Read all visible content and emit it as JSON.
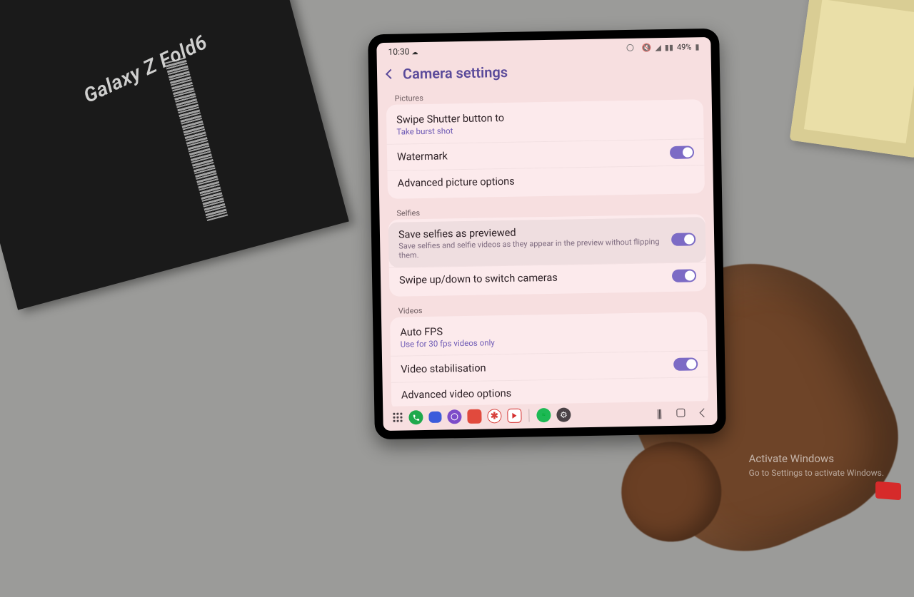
{
  "prop_box_label": "Galaxy Z Fold6",
  "status": {
    "time": "10:30",
    "battery_text": "49%",
    "icons": [
      "mute",
      "wifi",
      "signal1",
      "signal2"
    ]
  },
  "header": {
    "title": "Camera settings"
  },
  "sections": {
    "pictures": {
      "header": "Pictures",
      "swipe_shutter_title": "Swipe Shutter button to",
      "swipe_shutter_sub": "Take burst shot",
      "watermark_title": "Watermark",
      "advanced_pic_title": "Advanced picture options"
    },
    "selfies": {
      "header": "Selfies",
      "save_preview_title": "Save selfies as previewed",
      "save_preview_sub": "Save selfies and selfie videos as they appear in the preview without flipping them.",
      "swipe_cam_title": "Swipe up/down to switch cameras"
    },
    "videos": {
      "header": "Videos",
      "auto_fps_title": "Auto FPS",
      "auto_fps_sub": "Use for 30 fps videos only",
      "stabilisation_title": "Video stabilisation",
      "advanced_vid_title": "Advanced video options"
    }
  },
  "toggles": {
    "watermark": true,
    "save_selfies_previewed": true,
    "swipe_cameras": true,
    "video_stabilisation": true
  },
  "dock_apps": [
    {
      "name": "phone",
      "color": "#1ea94c",
      "icon": "phone"
    },
    {
      "name": "messages",
      "color": "#3b5bdb",
      "icon": "msg"
    },
    {
      "name": "browser",
      "color": "#7d4cc9",
      "icon": "O"
    },
    {
      "name": "app4",
      "color": "#e14a3d",
      "icon": "sq"
    },
    {
      "name": "app5",
      "color": "#d8433e",
      "icon": "star"
    },
    {
      "name": "youtube",
      "color": "#d42e2e",
      "icon": "play"
    },
    {
      "name": "spotify",
      "color": "#1db954",
      "icon": "spot"
    },
    {
      "name": "settings",
      "color": "#4a4246",
      "icon": "gear"
    }
  ],
  "windows_watermark": {
    "title": "Activate Windows",
    "sub": "Go to Settings to activate Windows."
  }
}
